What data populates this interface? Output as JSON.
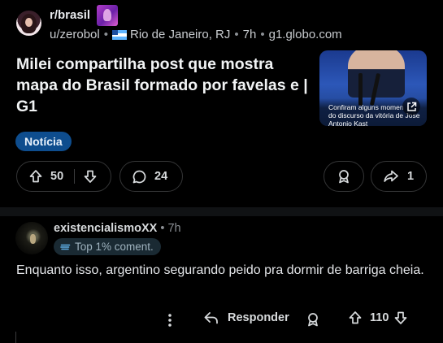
{
  "post": {
    "subreddit": "r/brasil",
    "author": "u/zerobol",
    "location": "Rio de Janeiro, RJ",
    "time": "7h",
    "domain": "g1.globo.com",
    "title": "Milei compartilha post que mostra mapa do Brasil formado por favelas e | G1",
    "thumbnail": {
      "caption_line1": "Confiram alguns momen",
      "caption_line2": "do discurso da vitória de Jose",
      "caption_line3": "Antonio Kast"
    },
    "flair": "Notícia",
    "votes": "50",
    "comments": "24",
    "shares": "1",
    "colors": {
      "flair_bg": "#0e4d8e",
      "background": "#000000"
    }
  },
  "comment": {
    "username": "existencialismoXX",
    "time": "7h",
    "badge": "Top 1% coment.",
    "text": "Enquanto isso, argentino segurando peido pra dormir de barriga cheia.",
    "reply_label": "Responder",
    "votes": "110"
  },
  "icons": {
    "upvote": "arrow-up-icon",
    "downvote": "arrow-down-icon",
    "comment": "speech-bubble-icon",
    "award": "award-icon",
    "share": "share-arrow-icon",
    "more": "more-vertical-icon",
    "reply": "reply-arrow-icon",
    "external": "external-link-icon"
  }
}
